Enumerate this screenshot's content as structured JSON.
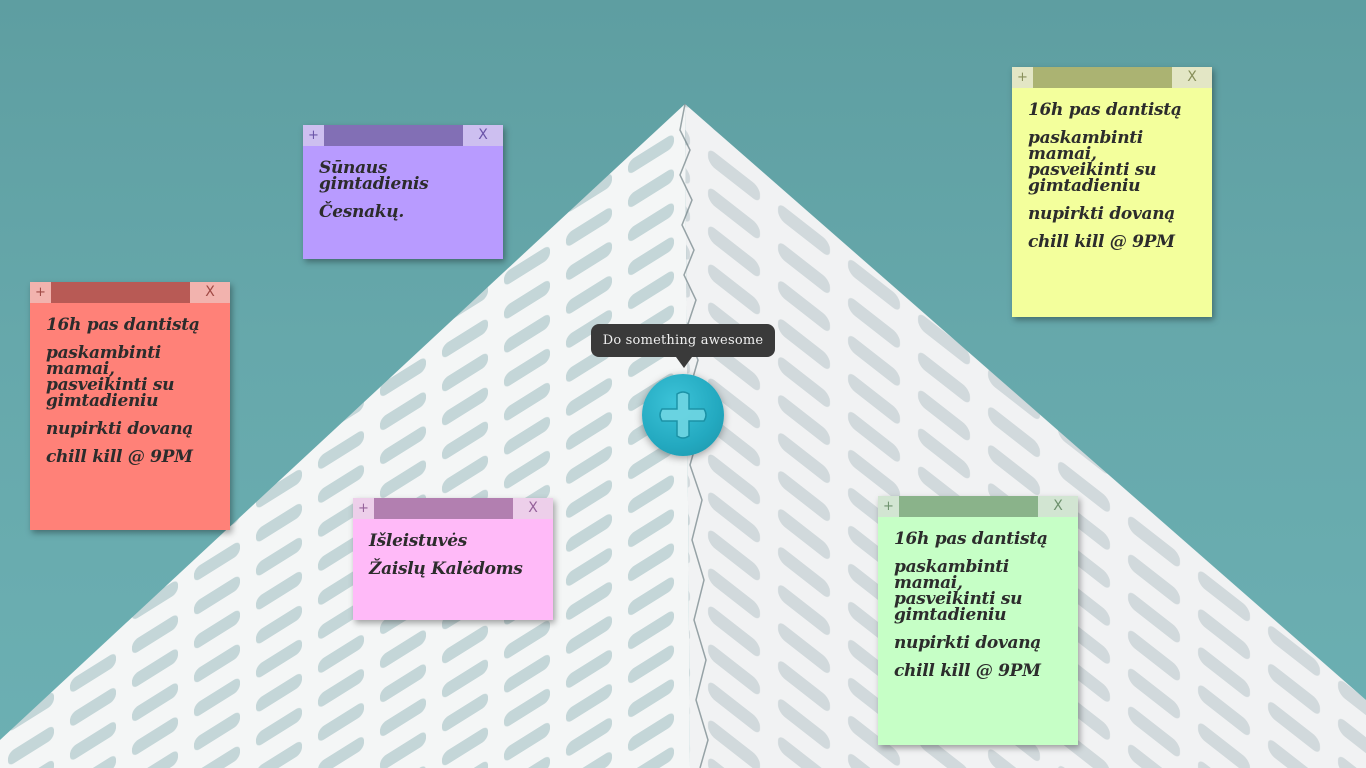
{
  "notes": [
    {
      "id": "note-1",
      "color": "#b89bff",
      "add_label": "+",
      "close_label": "X",
      "lines": [
        "Sūnaus gimtadienis",
        "Česnakų."
      ]
    },
    {
      "id": "note-2",
      "color": "#ff8178",
      "add_label": "+",
      "close_label": "X",
      "lines": [
        "16h pas dantistą",
        "paskambinti mamai, pasveikinti su gimtadieniu",
        "nupirkti dovaną",
        "chill kill @ 9PM"
      ]
    },
    {
      "id": "note-3",
      "color": "#ffbaf8",
      "add_label": "+",
      "close_label": "X",
      "lines": [
        "Išleistuvės",
        "Žaislų Kalėdoms"
      ]
    },
    {
      "id": "note-4",
      "color": "#f3ff9c",
      "add_label": "+",
      "close_label": "X",
      "lines": [
        "16h pas dantistą",
        "paskambinti mamai, pasveikinti su gimtadieniu",
        "nupirkti dovaną",
        "chill kill @ 9PM"
      ]
    },
    {
      "id": "note-5",
      "color": "#c6ffc6",
      "add_label": "+",
      "close_label": "X",
      "lines": [
        "16h pas dantistą",
        "paskambinti mamai, pasveikinti su gimtadieniu",
        "nupirkti dovaną",
        "chill kill @ 9PM"
      ]
    }
  ],
  "add_button": {
    "tooltip": "Do something awesome",
    "icon": "plus-icon",
    "color": "#23a9c0"
  },
  "background": {
    "color": "#66a8ab"
  }
}
